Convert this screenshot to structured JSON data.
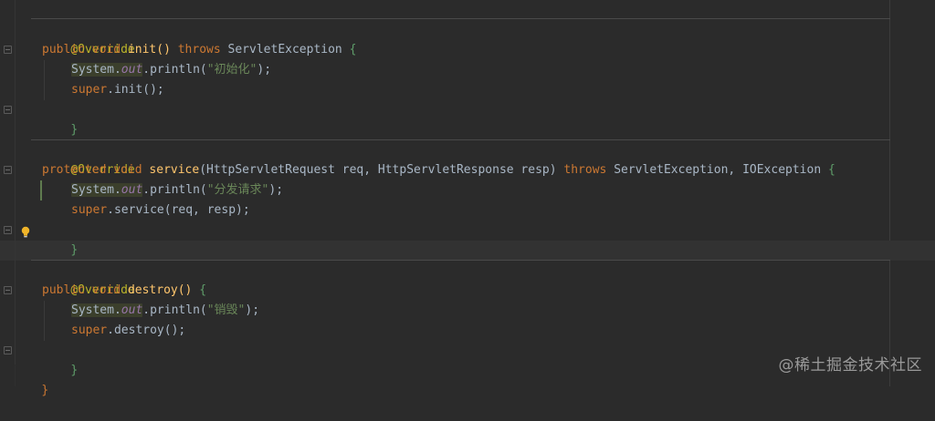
{
  "methods": [
    {
      "annotation": "@Override",
      "modifier": "public",
      "return_type": "void",
      "name": "init",
      "params": "()",
      "throws_kw": "throws",
      "exceptions": "ServletException",
      "body": [
        {
          "obj": "System",
          "field": "out",
          "call": ".println(",
          "str": "\"初始化\"",
          "end": ");"
        },
        {
          "super_kw": "super",
          "rest": ".init();"
        }
      ]
    },
    {
      "annotation": "@Override",
      "modifier": "protected",
      "return_type": "void",
      "name": "service",
      "params": "(HttpServletRequest req, HttpServletResponse resp)",
      "throws_kw": "throws",
      "exceptions": "ServletException, IOException",
      "body": [
        {
          "obj": "System",
          "field": "out",
          "call": ".println(",
          "str": "\"分发请求\"",
          "end": ");"
        },
        {
          "super_kw": "super",
          "rest": ".service(req, resp);"
        }
      ]
    },
    {
      "annotation": "@Override",
      "modifier": "public",
      "return_type": "void",
      "name": "destroy",
      "params": "()",
      "throws_kw": "",
      "exceptions": "",
      "body": [
        {
          "obj": "System",
          "field": "out",
          "call": ".println(",
          "str": "\"销毁\"",
          "end": ");"
        },
        {
          "super_kw": "super",
          "rest": ".destroy();"
        }
      ]
    }
  ],
  "braces": {
    "open": "{",
    "close": "}"
  },
  "watermark": "@稀土掘金技术社区",
  "colors": {
    "background": "#2b2b2b",
    "keyword": "#cc7832",
    "annotation": "#bbb529",
    "method": "#ffc66d",
    "string": "#6a8759",
    "field": "#9876aa",
    "text": "#a9b7c6"
  },
  "icons": {
    "intention": "lightbulb-icon",
    "fold": "fold-marker-icon"
  }
}
